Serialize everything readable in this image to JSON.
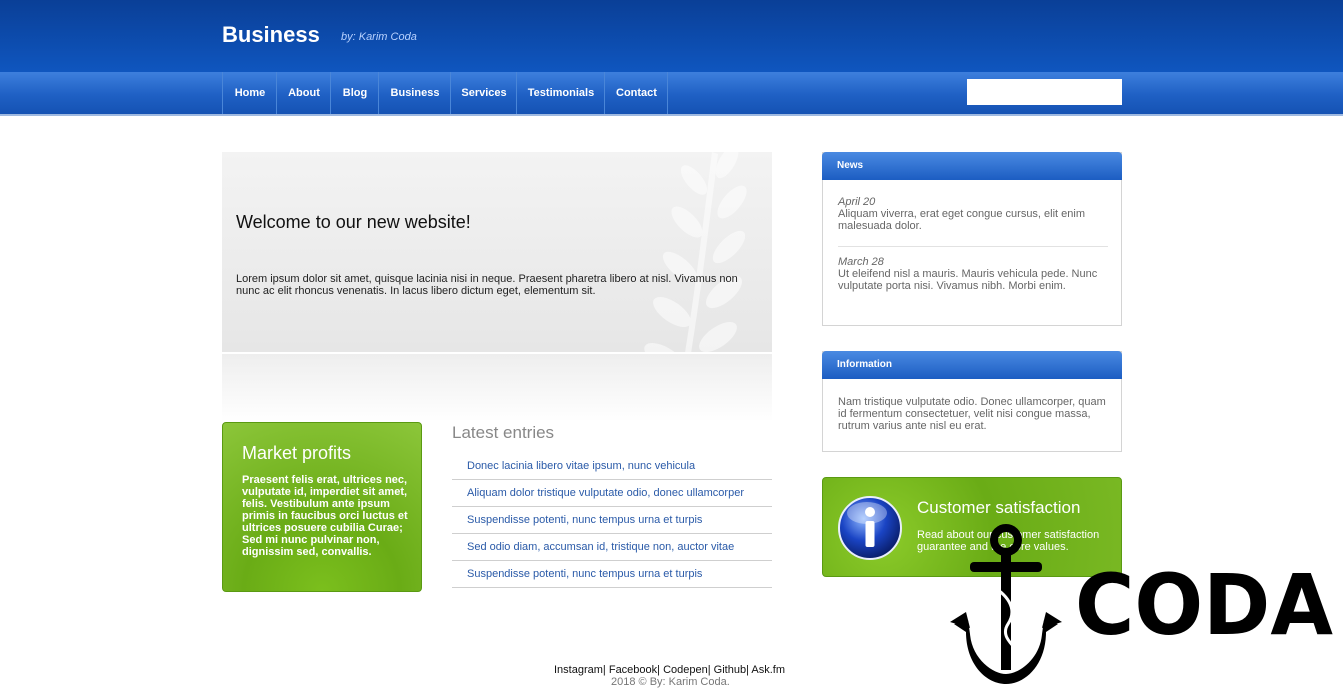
{
  "header": {
    "title": "Business",
    "byline": "by: Karim Coda"
  },
  "nav": {
    "items": [
      "Home",
      "About",
      "Blog",
      "Business",
      "Services",
      "Testimonials",
      "Contact"
    ]
  },
  "search": {
    "value": "",
    "placeholder": ""
  },
  "hero": {
    "title": "Welcome to our new website!",
    "text": "Lorem ipsum dolor sit amet, quisque lacinia nisi in neque. Praesent pharetra libero at nisl. Vivamus non nunc ac elit rhoncus venenatis. In lacus libero dictum eget, elementum sit."
  },
  "market": {
    "title": "Market profits",
    "text": "Praesent felis erat, ultrices nec, vulputate id, imperdiet sit amet, felis. Vestibulum ante ipsum primis in faucibus orci luctus et ultrices posuere cubilia Curae; Sed mi nunc pulvinar non, dignissim sed, convallis."
  },
  "latest": {
    "title": "Latest entries",
    "entries": [
      "Donec lacinia libero vitae ipsum, nunc vehicula",
      "Aliquam dolor tristique vulputate odio, donec ullamcorper",
      "Suspendisse potenti, nunc tempus urna et turpis",
      "Sed odio diam, accumsan id, tristique non, auctor vitae",
      "Suspendisse potenti, nunc tempus urna et turpis"
    ]
  },
  "news": {
    "title": "News",
    "items": [
      {
        "date": "April 20",
        "text": "Aliquam viverra, erat eget congue cursus, elit enim malesuada dolor."
      },
      {
        "date": "March 28",
        "text": "Ut eleifend nisl a mauris. Mauris vehicula pede. Nunc vulputate porta nisi. Vivamus nibh. Morbi enim."
      }
    ]
  },
  "information": {
    "title": "Information",
    "text": "Nam tristique vulputate odio. Donec ullamcorper, quam id fermentum consectetuer, velit nisi congue massa, rutrum varius ante nisl eu erat."
  },
  "customer": {
    "title": "Customer satisfaction",
    "text": "Read about our customer satisfaction guarantee and the core values.",
    "icon": "info-icon"
  },
  "overlay_logo": {
    "text": "CODA",
    "icon": "anchor-icon"
  },
  "footer": {
    "links": [
      "Instagram",
      "Facebook",
      "Codepen",
      "Github",
      "Ask.fm"
    ],
    "copyright": "2018 © By: Karim Coda."
  },
  "colors": {
    "header_blue": "#0f56bf",
    "nav_blue": "#1f60c4",
    "accent_green": "#6aac16",
    "link_blue": "#2a5aa8"
  }
}
